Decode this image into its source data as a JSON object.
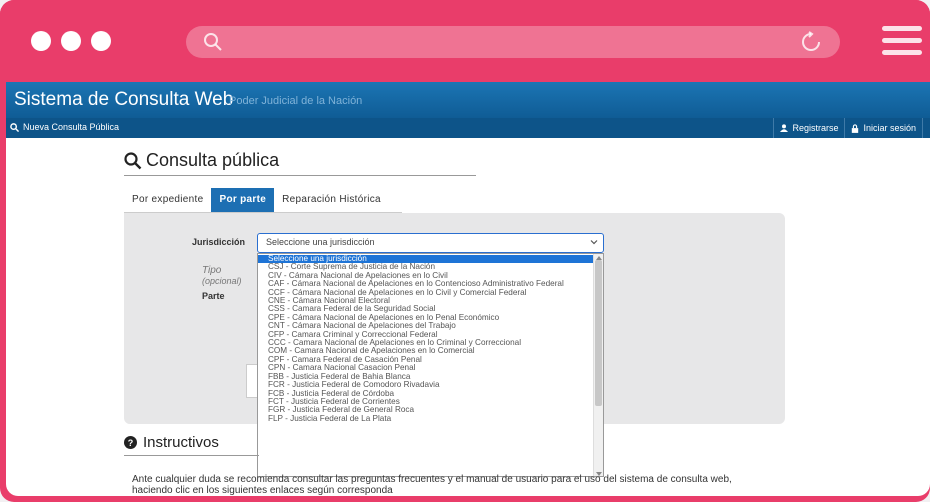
{
  "browser": {
    "url_bar": {
      "placeholder": ""
    },
    "icons": [
      "search-icon",
      "reload-icon",
      "menu-icon"
    ]
  },
  "header": {
    "title": "Sistema de Consulta Web",
    "subtitle": "Poder Judicial de la Nación"
  },
  "nav": {
    "left": {
      "label": "Nueva Consulta Pública"
    },
    "right": [
      {
        "label": "Registrarse"
      },
      {
        "label": "Iniciar sesión"
      }
    ]
  },
  "page": {
    "title": "Consulta pública"
  },
  "tabs": [
    {
      "label": "Por expediente",
      "active": false
    },
    {
      "label": "Por parte",
      "active": true
    },
    {
      "label": "Reparación Histórica",
      "active": false
    }
  ],
  "form": {
    "jurisdiccion_label": "Jurisdicción",
    "tipo_label": "Tipo",
    "opcional_label": "(opcional)",
    "parte_label": "Parte",
    "select_value": "Seleccione una jurisdicción",
    "options": [
      "Seleccione una jurisdicción",
      "CSJ - Corte Suprema de Justicia de la Nación",
      "CIV - Cámara Nacional de Apelaciones en lo Civil",
      "CAF - Cámara Nacional de Apelaciones en lo Contencioso Administrativo Federal",
      "CCF - Cámara Nacional de Apelaciones en lo Civil y Comercial Federal",
      "CNE - Cámara Nacional Electoral",
      "CSS - Camara Federal de la Seguridad Social",
      "CPE - Cámara Nacional de Apelaciones en lo Penal Económico",
      "CNT - Cámara Nacional de Apelaciones del Trabajo",
      "CFP - Camara Criminal y Correccional Federal",
      "CCC - Camara Nacional de Apelaciones en lo Criminal y Correccional",
      "COM - Camara Nacional de Apelaciones en lo Comercial",
      "CPF - Camara Federal de Casación Penal",
      "CPN - Camara Nacional Casacion Penal",
      "FBB - Justicia Federal de Bahia Blanca",
      "FCR - Justicia Federal de Comodoro Rivadavia",
      "FCB - Justicia Federal de Córdoba",
      "FCT - Justicia Federal de Corrientes",
      "FGR - Justicia Federal de General Roca",
      "FLP - Justicia Federal de La Plata"
    ]
  },
  "instructivos": {
    "title": "Instructivos",
    "text_line1": "Ante cualquier duda se recomienda consultar las preguntas frecuentes y el manual de usuario para el uso del sistema de consulta web,",
    "text_line2": "haciendo clic en los siguientes enlaces según corresponda"
  },
  "colors": {
    "browser_chrome": "#e93d6a",
    "header_blue": "#1c75b4",
    "nav_blue": "#0d5489",
    "active_tab": "#1d6fb3",
    "selected_option": "#1e74d6"
  }
}
